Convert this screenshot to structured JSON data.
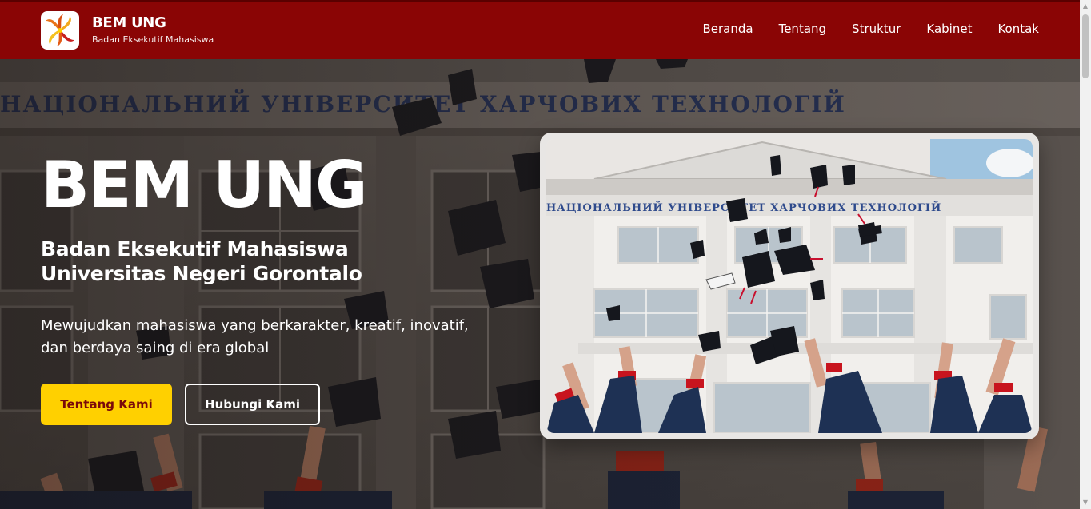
{
  "brand": {
    "title": "BEM UNG",
    "subtitle": "Badan Eksekutif Mahasiswa",
    "logo_icon": "bem-logo-icon"
  },
  "nav": {
    "items": [
      {
        "label": "Beranda"
      },
      {
        "label": "Tentang"
      },
      {
        "label": "Struktur"
      },
      {
        "label": "Kabinet"
      },
      {
        "label": "Kontak"
      }
    ]
  },
  "hero": {
    "title": "BEM UNG",
    "subtitle_line1": "Badan Eksekutif Mahasiswa",
    "subtitle_line2": "Universitas Negeri Gorontalo",
    "desc_line1": "Mewujudkan mahasiswa yang berkarakter, kreatif, inovatif,",
    "desc_line2": "dan berdaya saing di era global",
    "primary_button": "Tentang Kami",
    "secondary_button": "Hubungi Kami",
    "building_inscription": "НАЦІОНАЛЬНИЙ УНІВЕРСИТЕТ ХАРЧОВИХ ТЕХНОЛОГІЙ"
  },
  "colors": {
    "navbar": "#8a0505",
    "accent_yellow": "#ffd000",
    "button_text_red": "#7a0a0a"
  }
}
